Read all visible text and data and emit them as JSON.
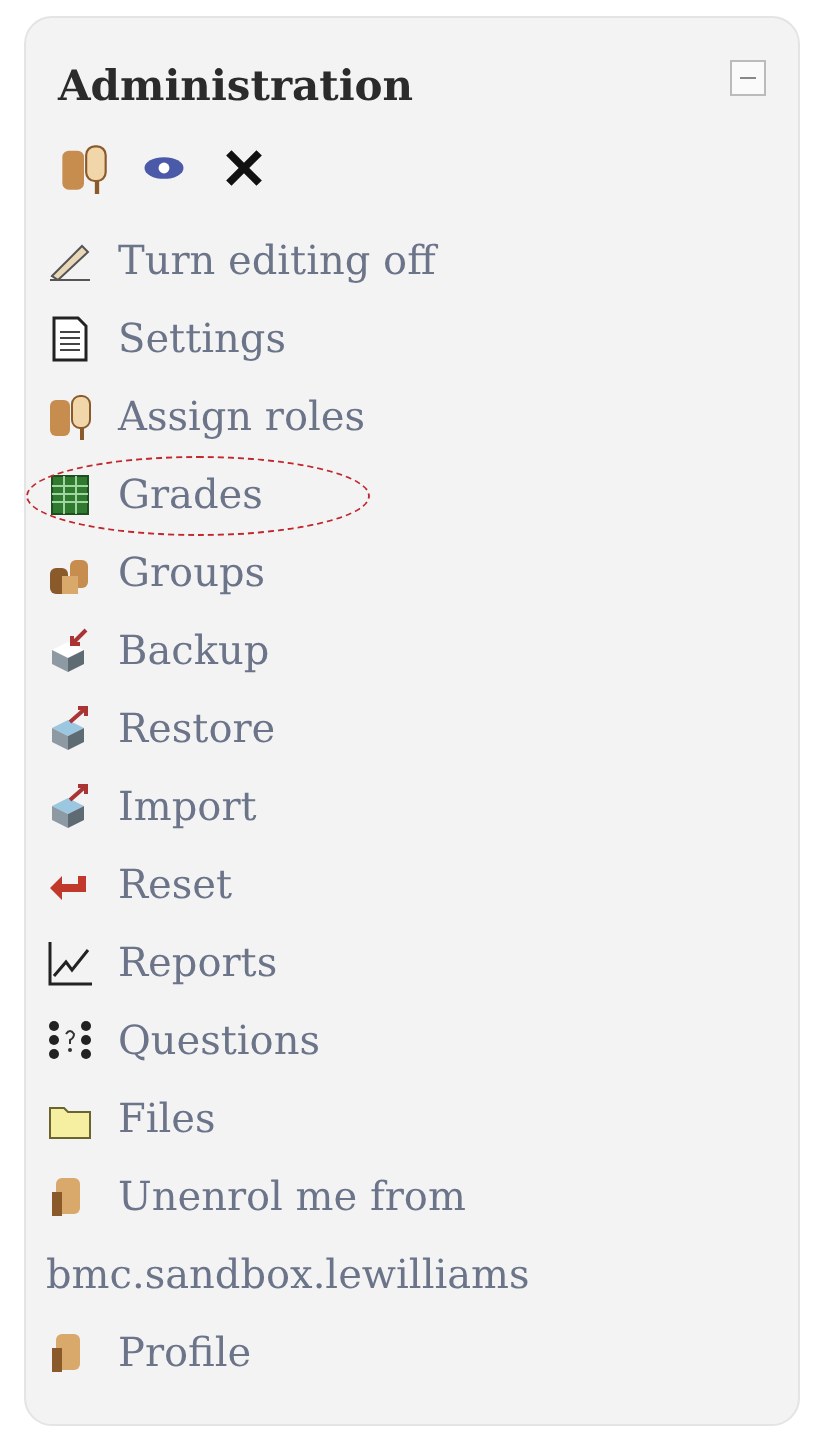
{
  "block": {
    "title": "Administration",
    "collapsed": false,
    "items": [
      {
        "label": "Turn editing off",
        "circled": false
      },
      {
        "label": "Settings",
        "circled": false
      },
      {
        "label": "Assign roles",
        "circled": false
      },
      {
        "label": "Grades",
        "circled": true
      },
      {
        "label": "Groups",
        "circled": false
      },
      {
        "label": "Backup",
        "circled": false
      },
      {
        "label": "Restore",
        "circled": false
      },
      {
        "label": "Import",
        "circled": false
      },
      {
        "label": "Reset",
        "circled": false
      },
      {
        "label": "Reports",
        "circled": false
      },
      {
        "label": "Questions",
        "circled": false
      },
      {
        "label": "Files",
        "circled": false
      },
      {
        "label": "Unenrol me from bmc.sandbox.lewilliams",
        "circled": false
      },
      {
        "label": "Profile",
        "circled": false
      }
    ]
  }
}
